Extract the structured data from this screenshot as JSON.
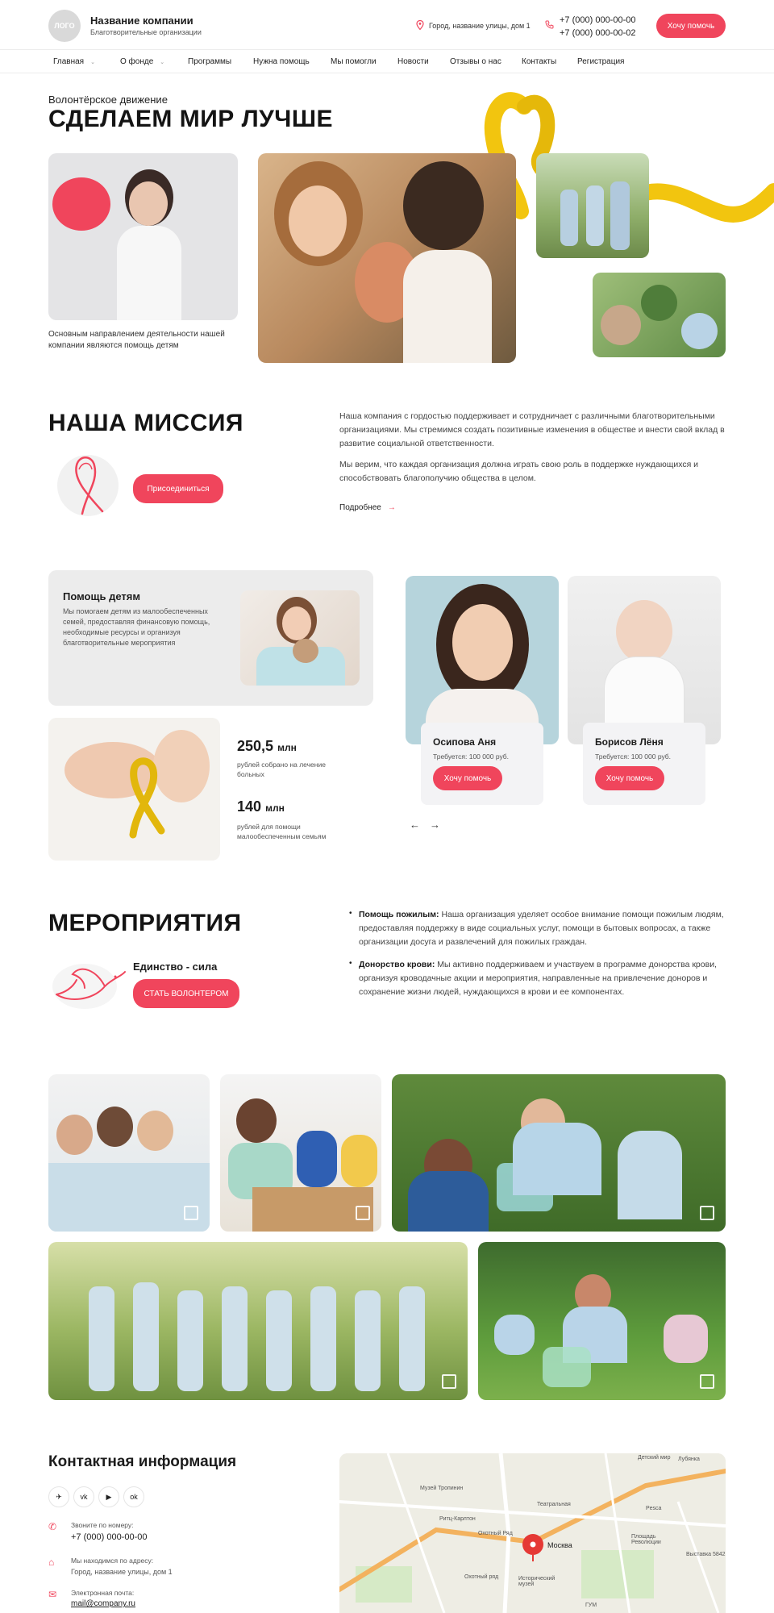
{
  "header": {
    "logo_text": "ЛОГО",
    "company_name": "Название компании",
    "company_subtitle": "Благотворительные организации",
    "address": "Город, название улицы, дом 1",
    "phone_1": "+7 (000) 000-00-00",
    "phone_2": "+7 (000) 000-00-02",
    "cta_label": "Хочу помочь"
  },
  "nav": {
    "items": [
      {
        "label": "Главная",
        "dropdown": true
      },
      {
        "label": "О фонде",
        "dropdown": true
      },
      {
        "label": "Программы"
      },
      {
        "label": "Нужна помощь"
      },
      {
        "label": "Мы помогли"
      },
      {
        "label": "Новости"
      },
      {
        "label": "Отзывы о нас"
      },
      {
        "label": "Контакты"
      },
      {
        "label": "Регистрация"
      }
    ],
    "chevron": "⌄"
  },
  "hero": {
    "eyebrow": "Волонтёрское движение",
    "title": "СДЕЛАЕМ МИР ЛУЧШЕ",
    "caption": "Основным направлением деятельности нашей компании являются помощь детям"
  },
  "mission": {
    "title": "НАША МИССИЯ",
    "join_label": "Присоединиться",
    "paragraph_1": "Наша компания с гордостью поддерживает и сотрудничает с различными благотворительными организациями. Мы стремимся создать позитивные изменения в обществе и внести свой вклад в развитие социальной ответственности.",
    "paragraph_2": "Мы верим, что каждая организация должна играть свою роль в поддержке нуждающихся и способствовать благополучию общества в целом.",
    "more_label": "Подробнее",
    "more_arrow": "→"
  },
  "help": {
    "title": "Помощь детям",
    "description": "Мы помогаем детям из малообеспеченных семей, предоставляя финансовую помощь, необходимые ресурсы и организуя благотворительные мероприятия",
    "stats": [
      {
        "value": "250,5",
        "unit": "млн",
        "desc": "рублей собрано на лечение больных"
      },
      {
        "value": "140",
        "unit": "млн",
        "desc": "рублей для помощи малообеспеченным семьям"
      }
    ],
    "children": [
      {
        "name": "Осипова Аня",
        "need": "Требуется: 100 000 руб.",
        "button": "Хочу помочь"
      },
      {
        "name": "Борисов Лёня",
        "need": "Требуется: 100 000 руб.",
        "button": "Хочу помочь"
      }
    ],
    "prev_arrow": "←",
    "next_arrow": "→"
  },
  "events": {
    "title": "МЕРОПРИЯТИЯ",
    "slogan": "Единство - сила",
    "volunteer_label": "СТАТЬ ВОЛОНТЕРОМ",
    "items": [
      {
        "title": "Помощь пожилым:",
        "text": "Наша организация уделяет особое внимание помощи пожилым людям, предоставляя поддержку в виде социальных услуг, помощи в бытовых вопросах, а также организации досуга и развлечений для пожилых граждан."
      },
      {
        "title": "Донорство крови:",
        "text": "Мы активно поддерживаем и участвуем в программе донорства крови, организуя кроводачные акции и мероприятия, направленные на привлечение доноров и сохранение жизни людей, нуждающихся в крови и ее компонентах."
      }
    ]
  },
  "contacts": {
    "title": "Контактная информация",
    "social": [
      "telegram-icon",
      "vk-icon",
      "youtube-icon",
      "odnoklassniki-icon"
    ],
    "social_glyphs": [
      "✈",
      "vk",
      "▶",
      "ok"
    ],
    "phone_label": "Звоните по номеру:",
    "phone": "+7 (000) 000-00-00",
    "address_label": "Мы находимся по адресу:",
    "address": "Город, название улицы, дом 1",
    "email_label": "Электронная почта:",
    "email": "mail@company.ru"
  },
  "map": {
    "city": "Москва",
    "labels": [
      "Театральная",
      "Охотный Ряд",
      "Площадь Революции",
      "Исторический музей",
      "ГУМ",
      "Лубянка",
      "Выставка 5842",
      "Музей Тропинин",
      "Ритц-Карлтон",
      "Охотный ряд",
      "Детский мир",
      "Pesca"
    ]
  },
  "colors": {
    "accent": "#f0455c",
    "ribbon": "#f2c50f",
    "text": "#1c1c1c",
    "muted": "#555555",
    "card": "#ececec"
  }
}
